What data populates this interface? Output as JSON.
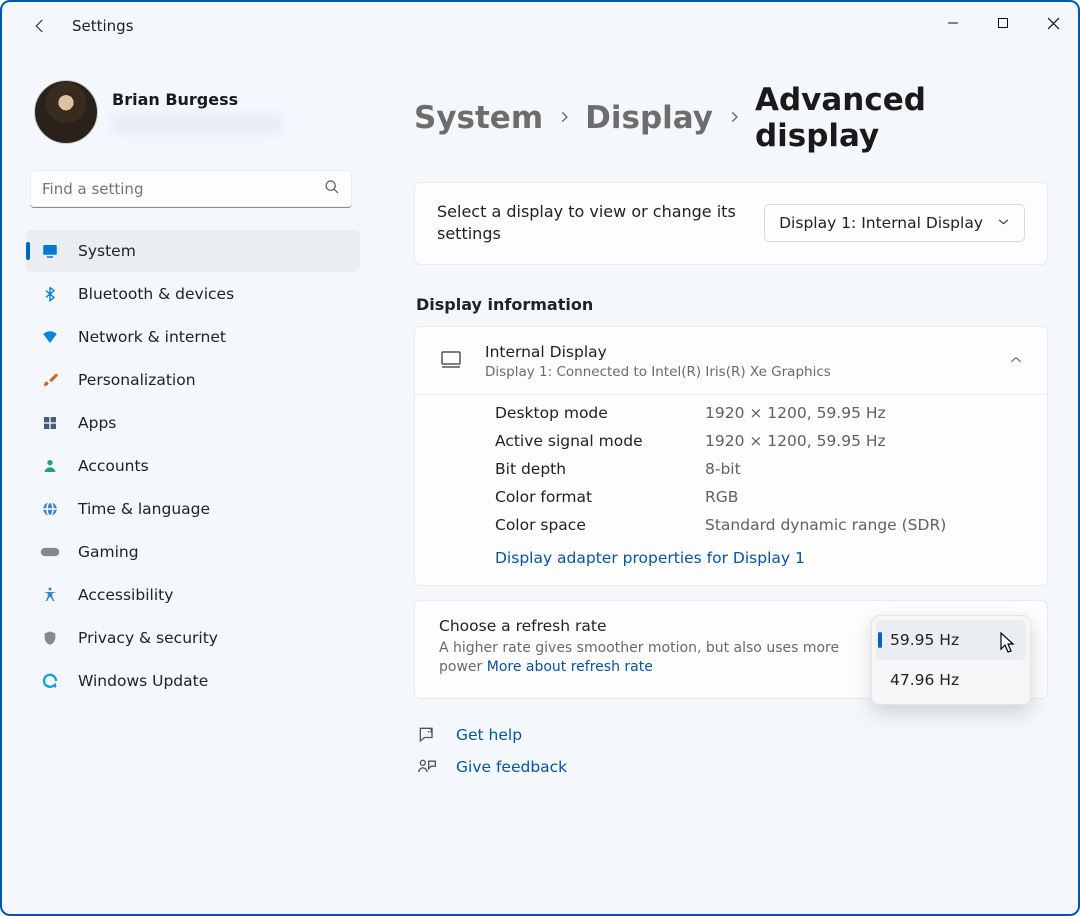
{
  "window": {
    "title": "Settings"
  },
  "profile": {
    "name": "Brian Burgess"
  },
  "search": {
    "placeholder": "Find a setting"
  },
  "nav": {
    "items": [
      {
        "label": "System",
        "icon": "display-icon",
        "color": "#0078d4",
        "selected": true
      },
      {
        "label": "Bluetooth & devices",
        "icon": "bluetooth-icon",
        "color": "#0078d4"
      },
      {
        "label": "Network & internet",
        "icon": "wifi-icon",
        "color": "#0a84d8"
      },
      {
        "label": "Personalization",
        "icon": "brush-icon",
        "color": "#d06a2c"
      },
      {
        "label": "Apps",
        "icon": "apps-icon",
        "color": "#4a5b7a"
      },
      {
        "label": "Accounts",
        "icon": "person-icon",
        "color": "#2aa06a"
      },
      {
        "label": "Time & language",
        "icon": "globe-icon",
        "color": "#3a86c8"
      },
      {
        "label": "Gaming",
        "icon": "gamepad-icon",
        "color": "#888"
      },
      {
        "label": "Accessibility",
        "icon": "accessibility-icon",
        "color": "#3a86c8"
      },
      {
        "label": "Privacy & security",
        "icon": "shield-icon",
        "color": "#888"
      },
      {
        "label": "Windows Update",
        "icon": "update-icon",
        "color": "#0aa0d8"
      }
    ]
  },
  "breadcrumb": {
    "root": "System",
    "mid": "Display",
    "current": "Advanced display"
  },
  "select_display": {
    "label": "Select a display to view or change its settings",
    "value": "Display 1: Internal Display"
  },
  "display_info": {
    "heading": "Display information",
    "name": "Internal Display",
    "sub": "Display 1: Connected to Intel(R) Iris(R) Xe Graphics",
    "rows": [
      {
        "k": "Desktop mode",
        "v": "1920 × 1200, 59.95 Hz"
      },
      {
        "k": "Active signal mode",
        "v": "1920 × 1200, 59.95 Hz"
      },
      {
        "k": "Bit depth",
        "v": "8-bit"
      },
      {
        "k": "Color format",
        "v": "RGB"
      },
      {
        "k": "Color space",
        "v": "Standard dynamic range (SDR)"
      }
    ],
    "adapter_link": "Display adapter properties for Display 1"
  },
  "refresh": {
    "title": "Choose a refresh rate",
    "desc": "A higher rate gives smoother motion, but also uses more power  ",
    "more": "More about refresh rate",
    "options": [
      "59.95 Hz",
      "47.96 Hz"
    ],
    "selected": 0
  },
  "footer": {
    "help": "Get help",
    "feedback": "Give feedback"
  }
}
